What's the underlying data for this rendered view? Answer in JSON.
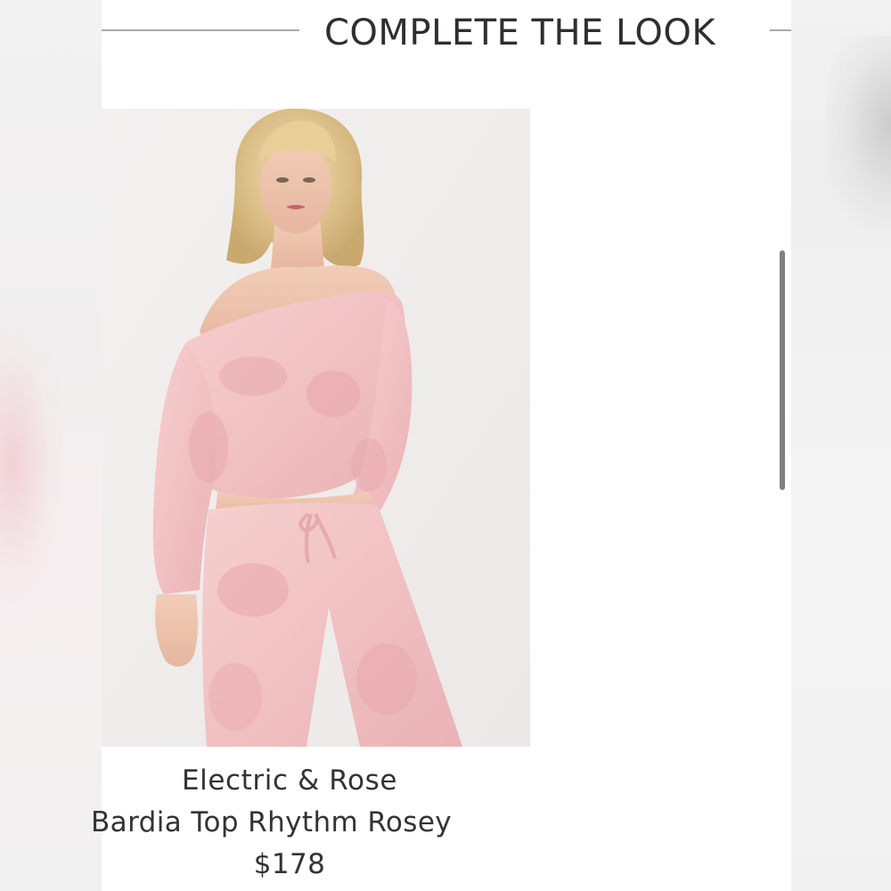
{
  "section": {
    "title": "COMPLETE THE LOOK"
  },
  "product": {
    "brand": "Electric & Rose",
    "name": "Bardia Top Rhythm Rosey",
    "price": "$178",
    "image_icon": "product-photo-pink-tie-dye-off-shoulder-top-and-pants"
  },
  "colors": {
    "title_text": "#2f2f2f",
    "body_text": "#333333",
    "rule": "#a9a9a9",
    "scrollbar": "#808080",
    "garment_pink": "#f1c4c4"
  }
}
